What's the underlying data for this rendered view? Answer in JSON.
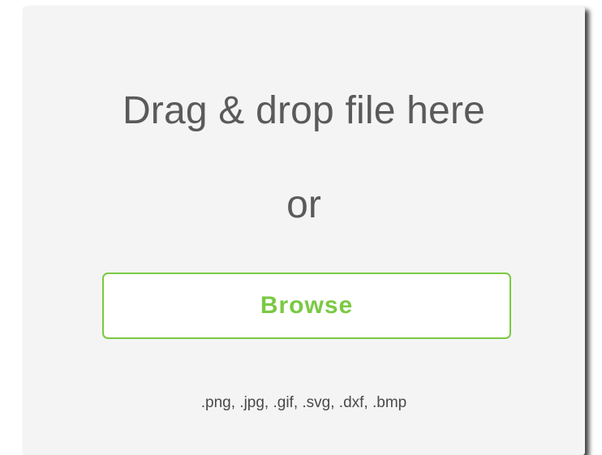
{
  "dropzone": {
    "headline": "Drag & drop file here",
    "or_text": "or",
    "browse_label": "Browse",
    "formats": ".png, .jpg, .gif, .svg, .dxf, .bmp"
  },
  "colors": {
    "accent": "#7ac943",
    "panel_background": "#f4f4f5",
    "text": "#5a5a5a"
  }
}
